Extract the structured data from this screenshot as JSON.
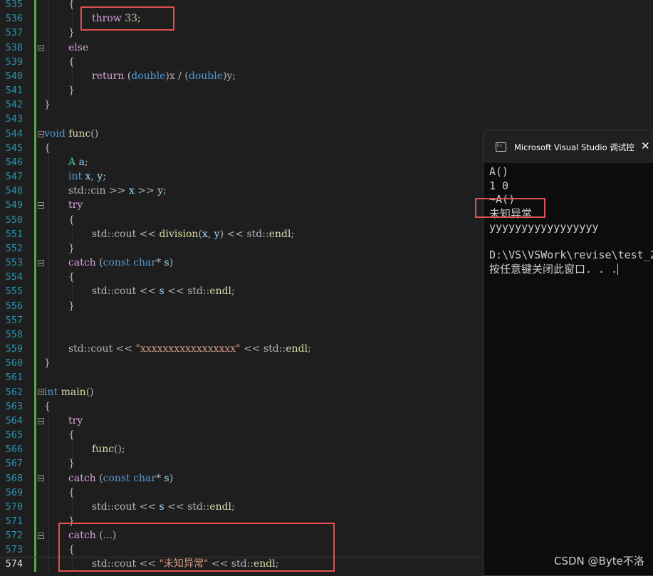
{
  "editor": {
    "line_numbers": [
      "535",
      "536",
      "537",
      "538",
      "539",
      "540",
      "541",
      "542",
      "543",
      "544",
      "545",
      "546",
      "547",
      "548",
      "549",
      "550",
      "551",
      "552",
      "553",
      "554",
      "555",
      "556",
      "557",
      "558",
      "559",
      "560",
      "561",
      "562",
      "563",
      "564",
      "565",
      "566",
      "567",
      "568",
      "569",
      "570",
      "571",
      "572",
      "573",
      "574"
    ],
    "lines": {
      "l535": [
        "{"
      ],
      "l536": [
        "throw",
        " 33;"
      ],
      "l537": [
        "}"
      ],
      "l538": [
        "else"
      ],
      "l539": [
        "{"
      ],
      "l540": [
        "return",
        " (",
        "double",
        ")",
        "x",
        " / (",
        "double",
        ")",
        "y",
        ";"
      ],
      "l541": [
        "}"
      ],
      "l542": [
        "}"
      ],
      "l544": [
        "void",
        " ",
        "func",
        "()"
      ],
      "l545": [
        "{"
      ],
      "l546": [
        "A",
        " ",
        "a",
        ";"
      ],
      "l547": [
        "int",
        " ",
        "x",
        ", ",
        "y",
        ";"
      ],
      "l548": [
        "std",
        "::",
        "cin",
        " >> ",
        "x",
        " >> ",
        "y",
        ";"
      ],
      "l549": [
        "try"
      ],
      "l550": [
        "{"
      ],
      "l551": [
        "std",
        "::",
        "cout",
        " << ",
        "division",
        "(",
        "x",
        ", ",
        "y",
        ") << ",
        "std",
        "::",
        "endl",
        ";"
      ],
      "l552": [
        "}"
      ],
      "l553": [
        "catch",
        " (",
        "const",
        " ",
        "char",
        "* ",
        "s",
        ")"
      ],
      "l554": [
        "{"
      ],
      "l555": [
        "std",
        "::",
        "cout",
        " << ",
        "s",
        " << ",
        "std",
        "::",
        "endl",
        ";"
      ],
      "l556": [
        "}"
      ],
      "l559": [
        "std",
        "::",
        "cout",
        " << ",
        "\"xxxxxxxxxxxxxxxxx\"",
        " << ",
        "std",
        "::",
        "endl",
        ";"
      ],
      "l560": [
        "}"
      ],
      "l562": [
        "int",
        " ",
        "main",
        "()"
      ],
      "l563": [
        "{"
      ],
      "l564": [
        "try"
      ],
      "l565": [
        "{"
      ],
      "l566": [
        "func",
        "();"
      ],
      "l567": [
        "}"
      ],
      "l568": [
        "catch",
        " (",
        "const",
        " ",
        "char",
        "* ",
        "s",
        ")"
      ],
      "l569": [
        "{"
      ],
      "l570": [
        "std",
        "::",
        "cout",
        " << ",
        "s",
        " << ",
        "std",
        "::",
        "endl",
        ";"
      ],
      "l571": [
        "}"
      ],
      "l572": [
        "catch",
        " (...)"
      ],
      "l573": [
        "{"
      ],
      "l574": [
        "std",
        "::",
        "cout",
        " << ",
        "\"未知异常\"",
        " << ",
        "std",
        "::",
        "endl",
        ";"
      ]
    }
  },
  "console": {
    "title": "Microsoft Visual Studio 调试控",
    "close_glyph": "✕",
    "lines": [
      "A()",
      "1 0",
      "~A()",
      "未知异常",
      "yyyyyyyyyyyyyyyyy",
      "",
      "D:\\VS\\VSWork\\revise\\test_2",
      "按任意键关闭此窗口. . ."
    ]
  },
  "watermark": "CSDN @Byte不洛",
  "colors": {
    "background": "#1e1e1e",
    "line_number": "#2b91af",
    "keyword": "#569cd6",
    "control_keyword": "#d8a0df",
    "function": "#dcdcaa",
    "type": "#4ec9b0",
    "variable": "#9cdcfe",
    "string": "#d69d85",
    "change_bar": "#57a64a",
    "highlight_box": "#e05050",
    "console_background": "#0c0c0c"
  }
}
